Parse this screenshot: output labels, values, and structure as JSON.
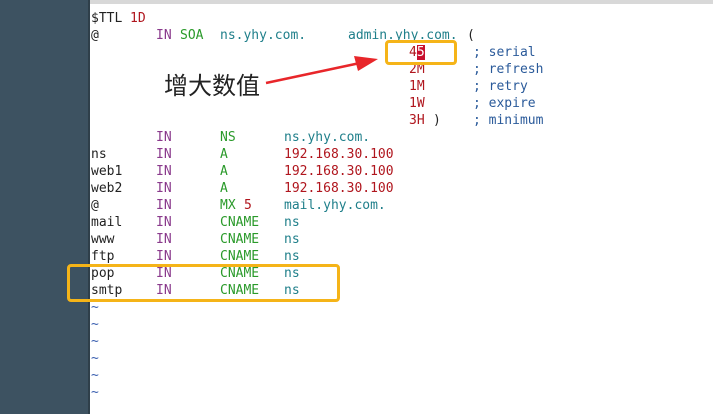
{
  "title_bar": {
    "text": ""
  },
  "editor": {
    "ttl": {
      "keyword": "$TTL",
      "value": "1D"
    },
    "soa": {
      "origin": "@",
      "class": "IN",
      "type": "SOA",
      "nameserver": "ns.yhy.com.",
      "admin": "admin.yhy.com.",
      "paren_open": "(",
      "serial": {
        "value_head": "4",
        "value_cursor": "5",
        "comment": "; serial"
      },
      "refresh": {
        "value": "2M",
        "comment": "; refresh"
      },
      "retry": {
        "value": "1M",
        "comment": "; retry"
      },
      "expire": {
        "value": "1W",
        "comment": "; expire"
      },
      "minimum": {
        "value": "3H",
        "paren_close": ")",
        "comment": "; minimum"
      }
    },
    "records": [
      {
        "name": "",
        "class": "IN",
        "type": "NS",
        "pref": "",
        "data": "ns.yhy.com."
      },
      {
        "name": "ns",
        "class": "IN",
        "type": "A",
        "pref": "",
        "data": "192.168.30.100"
      },
      {
        "name": "web1",
        "class": "IN",
        "type": "A",
        "pref": "",
        "data": "192.168.30.100"
      },
      {
        "name": "web2",
        "class": "IN",
        "type": "A",
        "pref": "",
        "data": "192.168.30.100"
      },
      {
        "name": "@",
        "class": "IN",
        "type": "MX",
        "pref": "5",
        "data": "mail.yhy.com."
      },
      {
        "name": "mail",
        "class": "IN",
        "type": "CNAME",
        "pref": "",
        "data": "ns"
      },
      {
        "name": "www",
        "class": "IN",
        "type": "CNAME",
        "pref": "",
        "data": "ns"
      },
      {
        "name": "ftp",
        "class": "IN",
        "type": "CNAME",
        "pref": "",
        "data": "ns"
      },
      {
        "name": "pop",
        "class": "IN",
        "type": "CNAME",
        "pref": "",
        "data": "ns"
      },
      {
        "name": "smtp",
        "class": "IN",
        "type": "CNAME",
        "pref": "",
        "data": "ns"
      }
    ],
    "empty_line_marker": "~"
  },
  "annotation": {
    "text": "增大数值"
  },
  "colors": {
    "gutter": "#3d5261",
    "highlight_box": "#f5b418",
    "arrow": "#e8262a",
    "cursor": "#c8102e"
  }
}
